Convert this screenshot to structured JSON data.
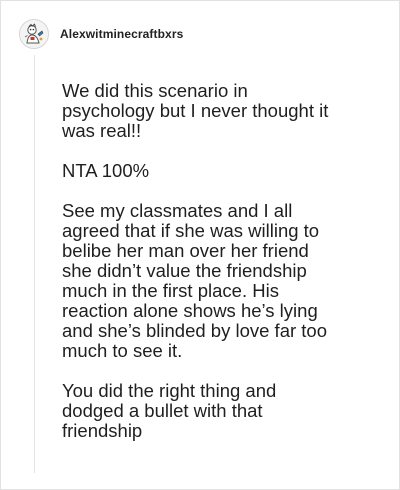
{
  "comment": {
    "username": "Alexwitminecraftbxrs",
    "avatar_icon": "cartoon-avatar-icon",
    "paragraphs": [
      "We did this scenario in\npsychology but I never thought it\nwas real!!",
      "NTA 100%",
      "See my classmates and I all\nagreed that if she was willing to\nbelibe her man over her friend\nshe didn’t value the friendship\nmuch in the first place. His\nreaction alone shows he’s lying\nand she’s blinded by love far too\nmuch to see it.",
      "You did the right thing and\ndodged a bullet with that\nfriendship"
    ]
  }
}
